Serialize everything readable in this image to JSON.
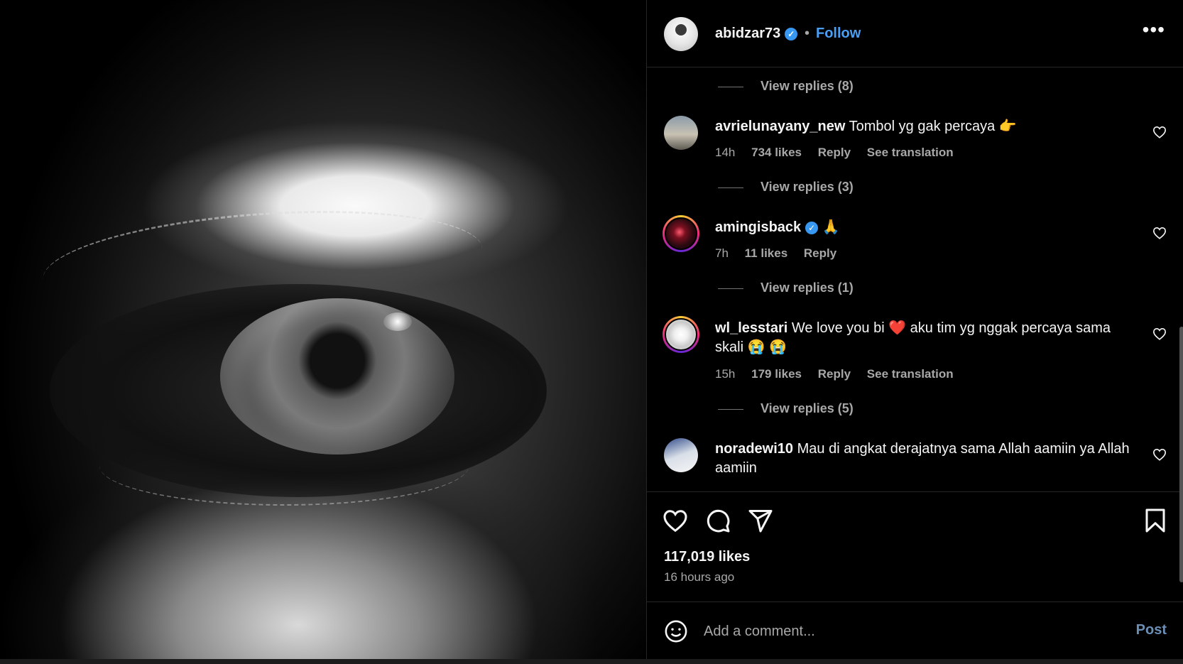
{
  "post": {
    "author": "abidzar73",
    "follow_label": "Follow",
    "dot": "•",
    "more_label": "•••",
    "likes": "117,019 likes",
    "time": "16 hours ago",
    "verified_mark": "✓"
  },
  "comments": [
    {
      "type": "replies",
      "label": "View replies (8)"
    },
    {
      "type": "comment",
      "user": "avrielunayany_new",
      "text": "Tombol yg gak percaya 👉",
      "time": "14h",
      "likes": "734 likes",
      "reply": "Reply",
      "translate": "See translation"
    },
    {
      "type": "replies",
      "label": "View replies (3)"
    },
    {
      "type": "comment",
      "user": "amingisback",
      "verified": true,
      "text": "🙏",
      "time": "7h",
      "likes": "11 likes",
      "reply": "Reply"
    },
    {
      "type": "replies",
      "label": "View replies (1)"
    },
    {
      "type": "comment",
      "user": "wl_lesstari",
      "text": "We love you bi ❤️ aku tim yg nggak percaya sama skali 😭 😭",
      "time": "15h",
      "likes": "179 likes",
      "reply": "Reply",
      "translate": "See translation"
    },
    {
      "type": "replies",
      "label": "View replies (5)"
    },
    {
      "type": "comment",
      "user": "noradewi10",
      "text": "Mau di angkat derajatnya sama Allah aamiin ya Allah aamiin"
    }
  ],
  "add_comment": {
    "placeholder": "Add a comment...",
    "post_label": "Post"
  },
  "icons": [
    "like-icon",
    "comment-icon",
    "share-icon",
    "save-icon",
    "emoji-icon",
    "heart-icon",
    "verified-icon"
  ],
  "colors": {
    "accent": "#4a9ff5",
    "verified": "#3897f0",
    "muted": "#a8a8a8"
  }
}
